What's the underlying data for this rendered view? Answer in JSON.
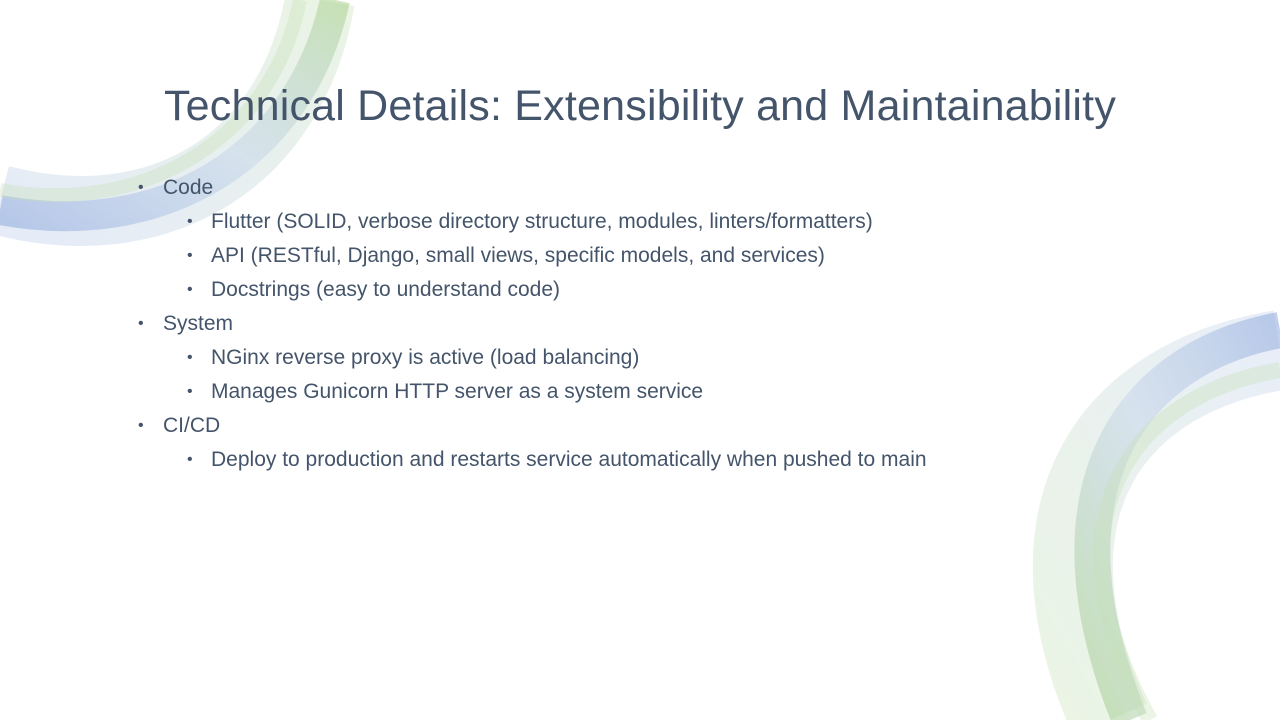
{
  "slide": {
    "title": "Technical Details: Extensibility and Maintainability",
    "bullet_glyph": "•",
    "sections": [
      {
        "label": "Code",
        "items": [
          "Flutter (SOLID, verbose directory structure, modules, linters/formatters)",
          "API (RESTful, Django, small views, specific models, and services)",
          "Docstrings (easy to understand code)"
        ]
      },
      {
        "label": "System",
        "items": [
          "NGinx reverse proxy is active (load balancing)",
          "Manages Gunicorn HTTP server as a system service"
        ]
      },
      {
        "label": "CI/CD",
        "items": [
          "Deploy to production and restarts service automatically when pushed to main"
        ]
      }
    ]
  },
  "colors": {
    "text": "#44546a",
    "accent_green": "#a9d18e",
    "accent_blue": "#8faadc"
  }
}
